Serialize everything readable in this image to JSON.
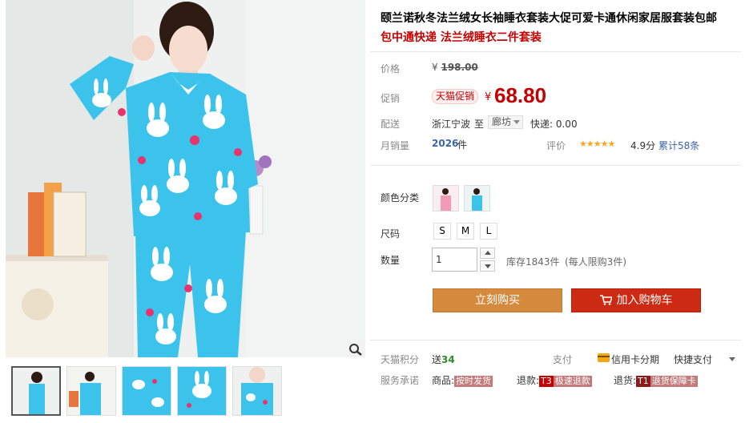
{
  "product": {
    "title": "颐兰诺秋冬法兰绒女长袖睡衣套装大促可爱卡通休闲家居服套装包邮",
    "subtitle": "包中通快递 法兰绒睡衣二件套装"
  },
  "price": {
    "label": "价格",
    "currency": "¥",
    "original": "198.00"
  },
  "promo": {
    "label": "促销",
    "tag": "天猫促销",
    "currency": "¥",
    "price": "68.80"
  },
  "shipping": {
    "label": "配送",
    "from": "浙江宁波",
    "to_word": "至",
    "city": "廊坊",
    "fee": "快递: 0.00"
  },
  "sales": {
    "label": "月销量",
    "count": "2026",
    "unit": "件",
    "rating_label": "评价",
    "stars": "★★★★★",
    "score": "4.9分",
    "total": "累计58条"
  },
  "options": {
    "color_label": "颜色分类",
    "size_label": "尺码",
    "sizes": [
      "S",
      "M",
      "L"
    ],
    "qty_label": "数量",
    "qty_value": "1",
    "stock": "库存1843件",
    "limit": "(每人限购3件)"
  },
  "actions": {
    "buy": "立刻购买",
    "cart": "加入购物车"
  },
  "footer": {
    "points_label": "天猫积分",
    "points_prefix": "送",
    "points_value": "34",
    "pay_label": "支付",
    "pay_method": "信用卡分期",
    "quick_pay": "快捷支付",
    "service_label": "服务承诺",
    "svc_goods": "商品:",
    "svc_goods_tag": "按时发货",
    "svc_refund": "退款:",
    "svc_refund_tag1": "T3",
    "svc_refund_tag2": "极速退款",
    "svc_return": "退货:",
    "svc_return_tag1": "T1",
    "svc_return_tag2": "退货保障卡"
  },
  "colors": {
    "sale_red": "#c40000",
    "buy_orange": "#d58a3e",
    "cart_red": "#cc2a12",
    "pajama_blue": "#3cc3ec"
  }
}
